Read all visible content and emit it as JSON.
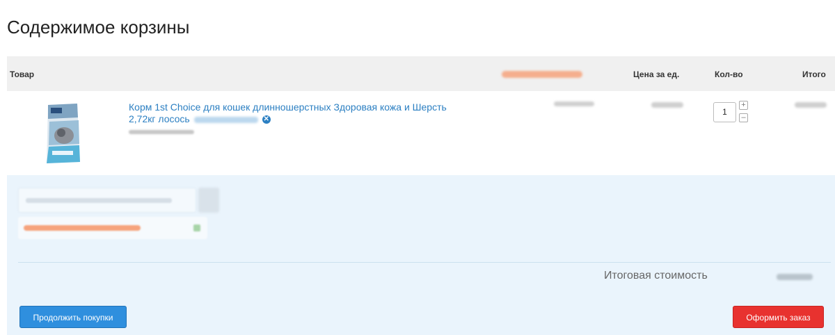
{
  "page": {
    "title": "Содержимое корзины"
  },
  "table": {
    "headers": {
      "product": "Товар",
      "price": "Цена за ед.",
      "qty": "Кол-во",
      "total": "Итого"
    }
  },
  "cart_items": [
    {
      "name": "Корм 1st Choice для кошек длинношерстных Здоровая кожа и Шерсть 2,72кг лосось",
      "quantity": "1",
      "qty_plus": "+",
      "qty_minus": "–"
    }
  ],
  "summary": {
    "total_label": "Итоговая стоимость"
  },
  "buttons": {
    "continue": "Продолжить покупки",
    "order": "Оформить заказ"
  },
  "colors": {
    "link": "#2b7fc2",
    "continue_button": "#2f8fde",
    "order_button": "#e8322f",
    "panel_bg": "#eaf4fc",
    "header_bg": "#f0f0f0"
  },
  "icons": {
    "remove": "close-circle-icon"
  }
}
